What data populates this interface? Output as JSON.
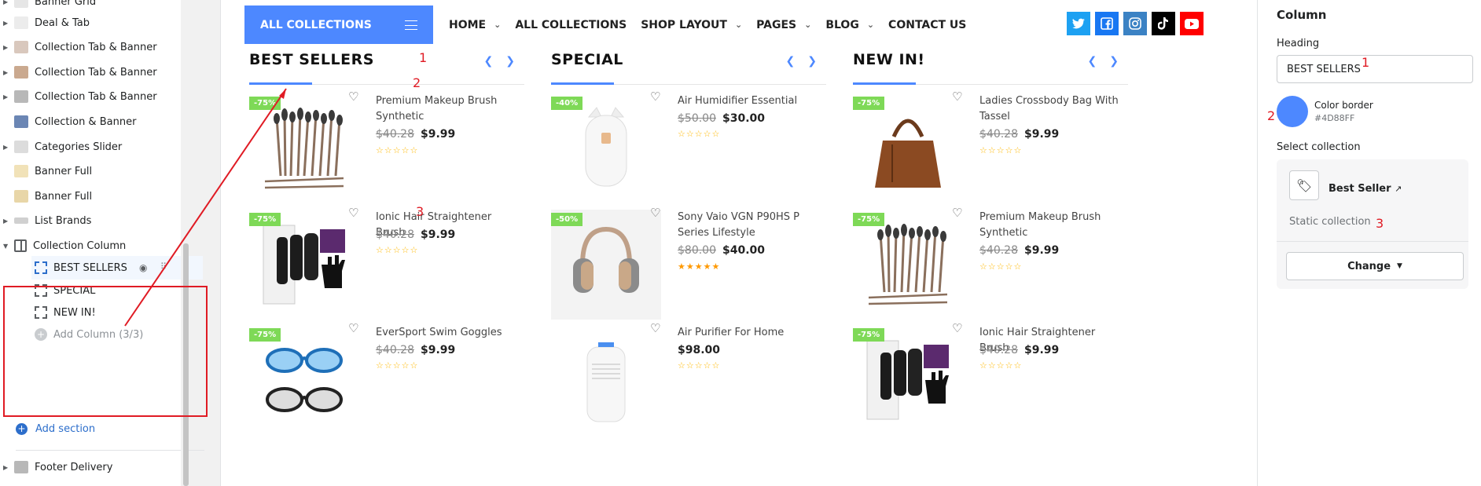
{
  "sidebar": {
    "items": [
      {
        "label": "Banner Grid"
      },
      {
        "label": "Deal & Tab"
      },
      {
        "label": "Collection Tab & Banner"
      },
      {
        "label": "Collection Tab & Banner"
      },
      {
        "label": "Collection Tab & Banner"
      },
      {
        "label": "Collection & Banner"
      },
      {
        "label": "Categories Slider"
      },
      {
        "label": "Banner Full"
      },
      {
        "label": "Banner Full"
      },
      {
        "label": "List Brands"
      },
      {
        "label": "Collection Column"
      }
    ],
    "children": [
      {
        "label": "BEST SELLERS"
      },
      {
        "label": "SPECIAL"
      },
      {
        "label": "NEW IN!"
      },
      {
        "label": "Add Column (3/3)"
      }
    ],
    "add_section": "Add section",
    "footer_item": "Footer Delivery"
  },
  "store": {
    "all_collections": "ALL COLLECTIONS",
    "menu": [
      "HOME",
      "ALL COLLECTIONS",
      "SHOP LAYOUT",
      "PAGES",
      "BLOG",
      "CONTACT US"
    ],
    "social_icons": [
      "twitter-icon",
      "facebook-icon",
      "instagram-icon",
      "tiktok-icon",
      "youtube-icon"
    ],
    "columns": [
      {
        "title": "BEST SELLERS",
        "products": [
          {
            "name": "Premium Makeup Brush Synthetic",
            "badge": "-75%",
            "old": "$40.28",
            "price": "$9.99"
          },
          {
            "name": "Ionic Hair Straightener Brush",
            "badge": "-75%",
            "old": "$40.28",
            "price": "$9.99"
          },
          {
            "name": "EverSport Swim Goggles",
            "badge": "-75%",
            "old": "$40.28",
            "price": "$9.99"
          }
        ]
      },
      {
        "title": "SPECIAL",
        "products": [
          {
            "name": "Air Humidifier Essential",
            "badge": "-40%",
            "old": "$50.00",
            "price": "$30.00"
          },
          {
            "name": "Sony Vaio VGN P90HS P Series Lifestyle",
            "badge": "-50%",
            "old": "$80.00",
            "price": "$40.00"
          },
          {
            "name": "Air Purifier For Home",
            "badge": "",
            "old": "",
            "price": "$98.00"
          }
        ]
      },
      {
        "title": "NEW IN!",
        "products": [
          {
            "name": "Ladies Crossbody Bag With Tassel",
            "badge": "-75%",
            "old": "$40.28",
            "price": "$9.99"
          },
          {
            "name": "Premium Makeup Brush Synthetic",
            "badge": "-75%",
            "old": "$40.28",
            "price": "$9.99"
          },
          {
            "name": "Ionic Hair Straightener Brush",
            "badge": "-75%",
            "old": "$40.28",
            "price": "$9.99"
          }
        ]
      }
    ],
    "annotations": [
      "1",
      "2",
      "3"
    ]
  },
  "panel": {
    "title": "Column",
    "heading_label": "Heading",
    "heading_value": "BEST SELLERS",
    "color_label": "Color border",
    "color_value": "#4D88FF",
    "select_label": "Select collection",
    "collection_name": "Best Seller",
    "collection_type": "Static collection",
    "change_label": "Change"
  },
  "colors": {
    "accent": "#4d88ff",
    "badge": "#7ed957",
    "annotation": "#e01b24"
  }
}
